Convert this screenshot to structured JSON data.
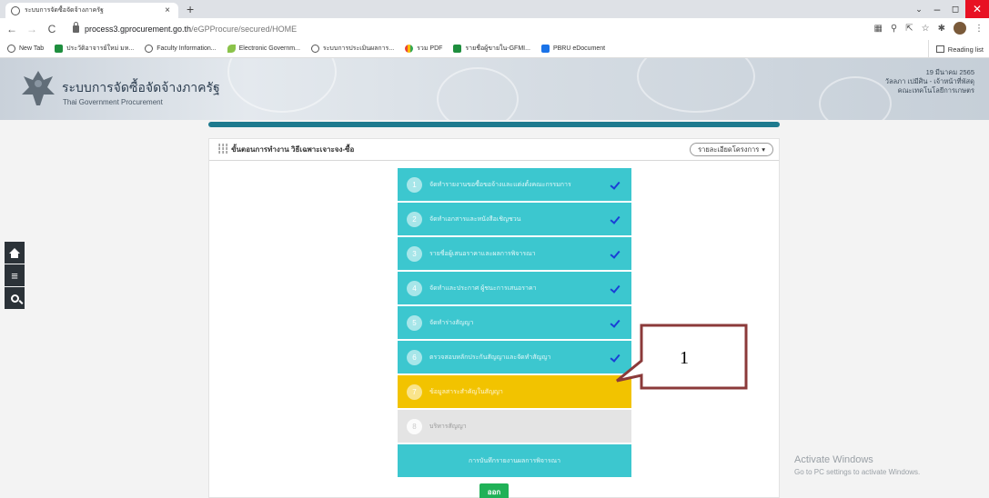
{
  "browser": {
    "tab_title": "ระบบการจัดซื้อจัดจ้างภาครัฐ",
    "url_host": "process3.gprocurement.go.th",
    "url_path": "/eGPProcure/secured/HOME",
    "bookmarks": [
      {
        "label": "New Tab",
        "icon": "globe"
      },
      {
        "label": "ประวัติอาจารย์ใหม่ มห...",
        "icon": "green"
      },
      {
        "label": "Faculty Information...",
        "icon": "globe"
      },
      {
        "label": "Electronic Governm...",
        "icon": "leaf"
      },
      {
        "label": "ระบบการประเมินผลการ...",
        "icon": "globe"
      },
      {
        "label": "รวม PDF",
        "icon": "multi"
      },
      {
        "label": "รายชื่อผู้ขายใน-GFMI...",
        "icon": "green"
      },
      {
        "label": "PBRU eDocument",
        "icon": "blue"
      }
    ],
    "reading_list": "Reading list"
  },
  "site": {
    "title_th": "ระบบการจัดซื้อจัดจ้างภาครัฐ",
    "title_en": "Thai Government Procurement",
    "user_line1": "19 มีนาคม 2565",
    "user_line2": "วัลลภา เปมีศิน - เจ้าหน้าที่พัสดุ",
    "user_line3": "คณะเทคโนโลยีการเกษตร"
  },
  "panel": {
    "title": "ขั้นตอนการทำงาน วิธีเฉพาะเจาะจง-ซื้อ",
    "detail_button": "รายละเอียดโครงการ"
  },
  "steps": [
    {
      "num": "1",
      "label": "จัดทำรายงานขอซื้อขอจ้างและแต่งตั้งคณะกรรมการ",
      "status": "done"
    },
    {
      "num": "2",
      "label": "จัดทำเอกสารและหนังสือเชิญชวน",
      "status": "done"
    },
    {
      "num": "3",
      "label": "รายชื่อผู้เสนอราคาและผลการพิจารณา",
      "status": "done"
    },
    {
      "num": "4",
      "label": "จัดทำและประกาศ ผู้ชนะการเสนอราคา",
      "status": "done"
    },
    {
      "num": "5",
      "label": "จัดทำร่างสัญญา",
      "status": "done"
    },
    {
      "num": "6",
      "label": "ตรวจสอบหลักประกันสัญญาและจัดทำสัญญา",
      "status": "done"
    },
    {
      "num": "7",
      "label": "ข้อมูลสาระสำคัญในสัญญา",
      "status": "current"
    },
    {
      "num": "8",
      "label": "บริหารสัญญา",
      "status": "disabled"
    }
  ],
  "extra_step": "การบันทึกรายงานผลการพิจารณา",
  "exit_button": "ออก",
  "callout_number": "1",
  "watermark": {
    "line1": "Activate Windows",
    "line2": "Go to PC settings to activate Windows."
  }
}
